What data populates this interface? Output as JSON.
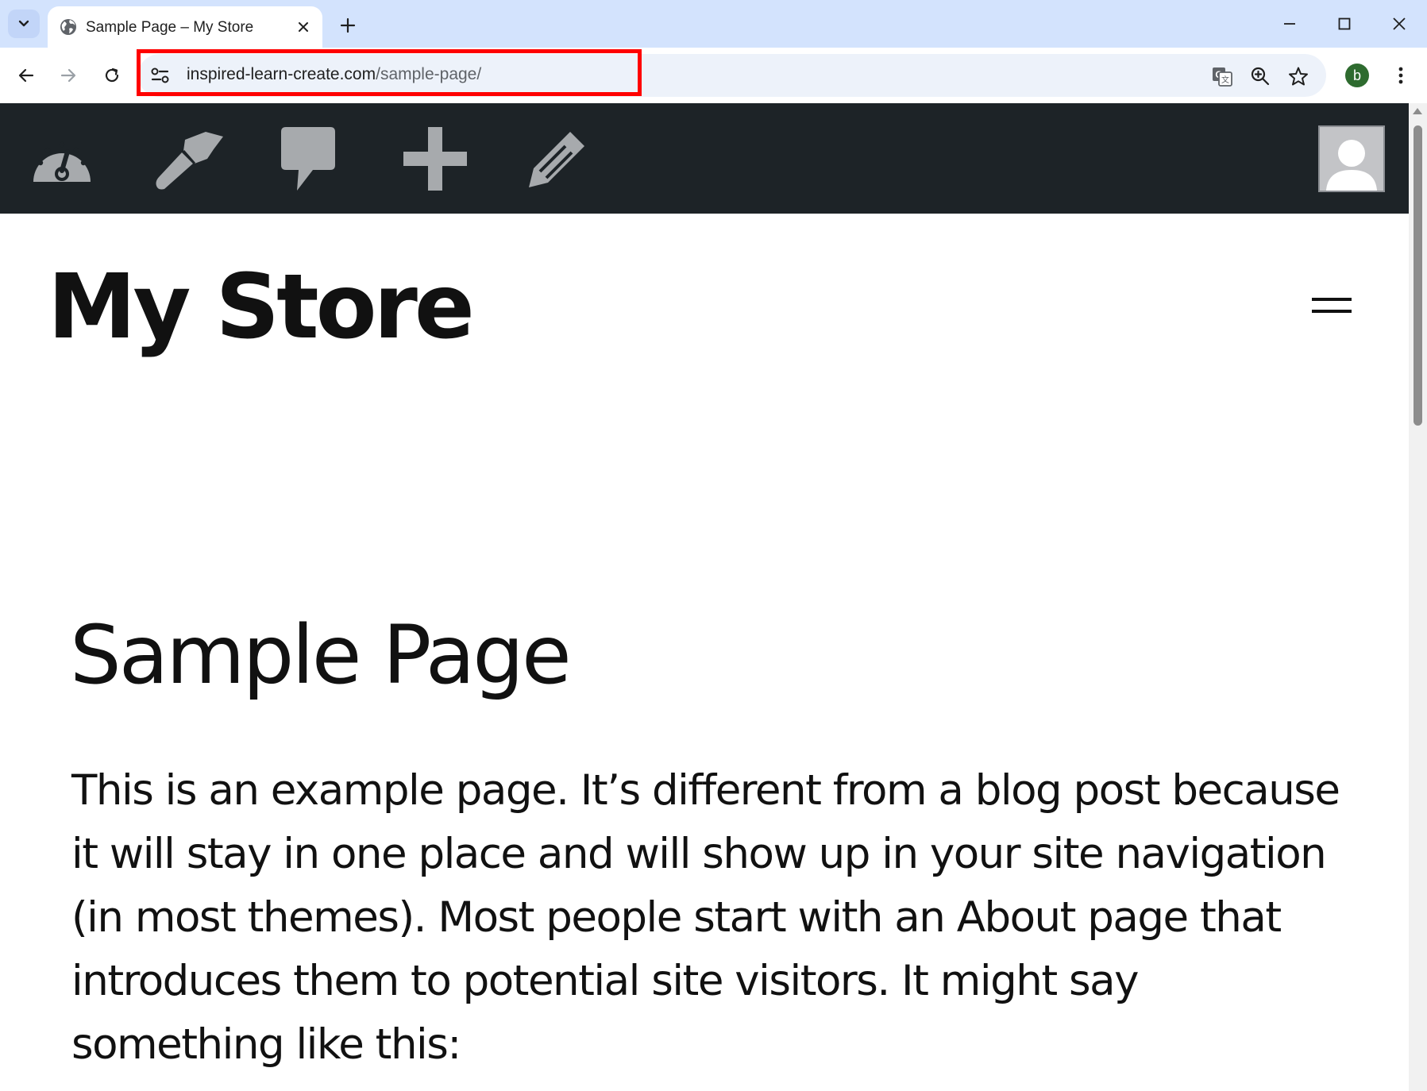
{
  "browser": {
    "tab": {
      "title": "Sample Page – My Store"
    },
    "address_bar": {
      "domain": "inspired-learn-create.com",
      "path": "/sample-page/"
    },
    "profile_initial": "b",
    "colors": {
      "tabstrip": "#d3e3fd",
      "omnibox": "#edf2fa",
      "highlight": "#ff0000",
      "profile": "#2e6b2f"
    }
  },
  "admin_bar": {
    "items": [
      {
        "icon": "dashboard-icon"
      },
      {
        "icon": "customize-brush-icon"
      },
      {
        "icon": "comments-icon"
      },
      {
        "icon": "new-content-plus-icon"
      },
      {
        "icon": "edit-pencil-icon"
      }
    ],
    "avatar_icon": "user-avatar-icon",
    "colors": {
      "background": "#1d2327",
      "icon": "#a7aaad"
    }
  },
  "site": {
    "title": "My Store",
    "menu_icon": "hamburger-menu-icon"
  },
  "page": {
    "title": "Sample Page",
    "body": "This is an example page. It’s different from a blog post because it will stay in one place and will show up in your site navigation (in most themes). Most people start with an About page that introduces them to potential site visitors. It might say something like this:"
  }
}
